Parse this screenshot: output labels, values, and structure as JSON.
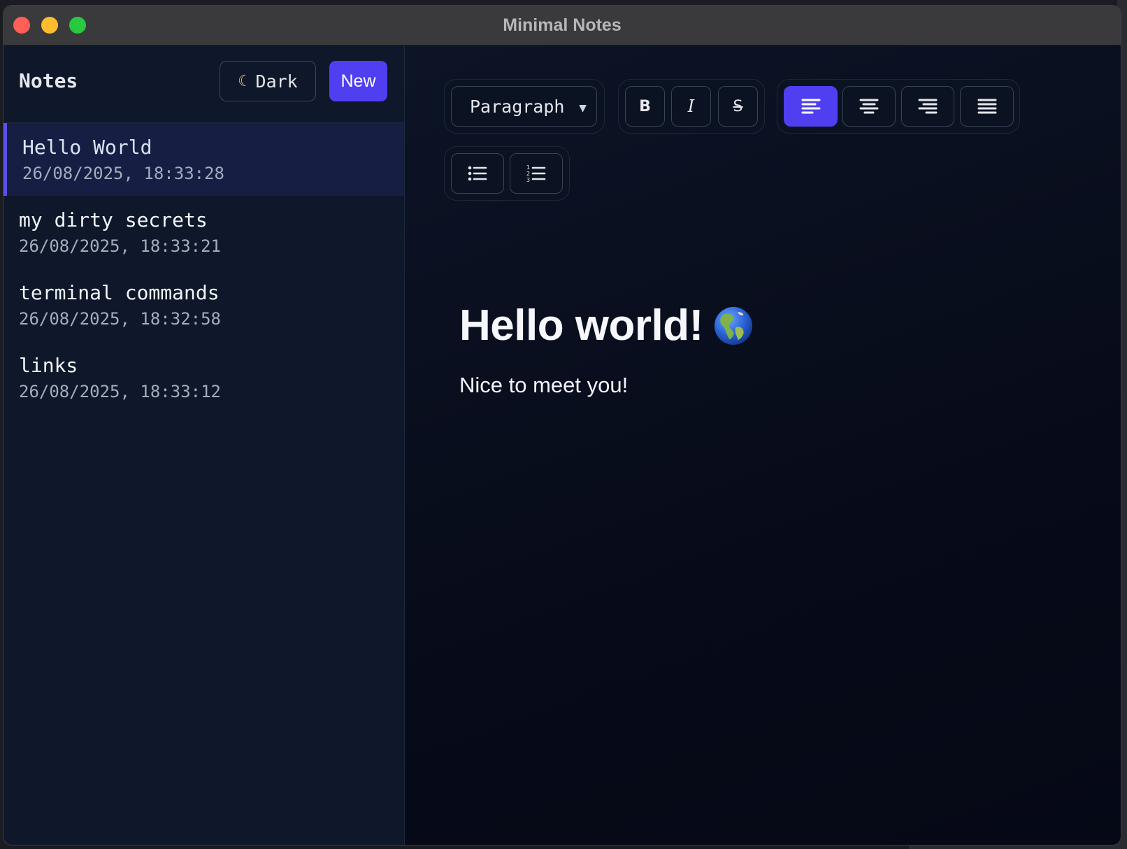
{
  "window": {
    "title": "Minimal Notes"
  },
  "sidebar": {
    "title": "Notes",
    "theme_button": {
      "icon": "moon-icon",
      "label": "Dark"
    },
    "new_button": {
      "label": "New"
    },
    "notes": [
      {
        "title": "Hello World",
        "date": "26/08/2025, 18:33:28",
        "active": true
      },
      {
        "title": "my dirty secrets",
        "date": "26/08/2025, 18:33:21",
        "active": false
      },
      {
        "title": "terminal commands",
        "date": "26/08/2025, 18:32:58",
        "active": false
      },
      {
        "title": "links",
        "date": "26/08/2025, 18:33:12",
        "active": false
      }
    ]
  },
  "toolbar": {
    "block_type": "Paragraph",
    "bold_label": "B",
    "italic_label": "I",
    "strike_label": "S",
    "alignment_active": "left",
    "align_icons": [
      "align-left-icon",
      "align-center-icon",
      "align-right-icon",
      "align-justify-icon"
    ],
    "list_icons": [
      "bullet-list-icon",
      "numbered-list-icon"
    ]
  },
  "editor": {
    "heading": "Hello world!",
    "heading_emoji": "globe-americas-icon",
    "paragraph": "Nice to meet you!"
  },
  "colors": {
    "accent": "#4f3ff0",
    "sidebar_bg": "#0f172a",
    "editor_bg": "#070b19"
  }
}
